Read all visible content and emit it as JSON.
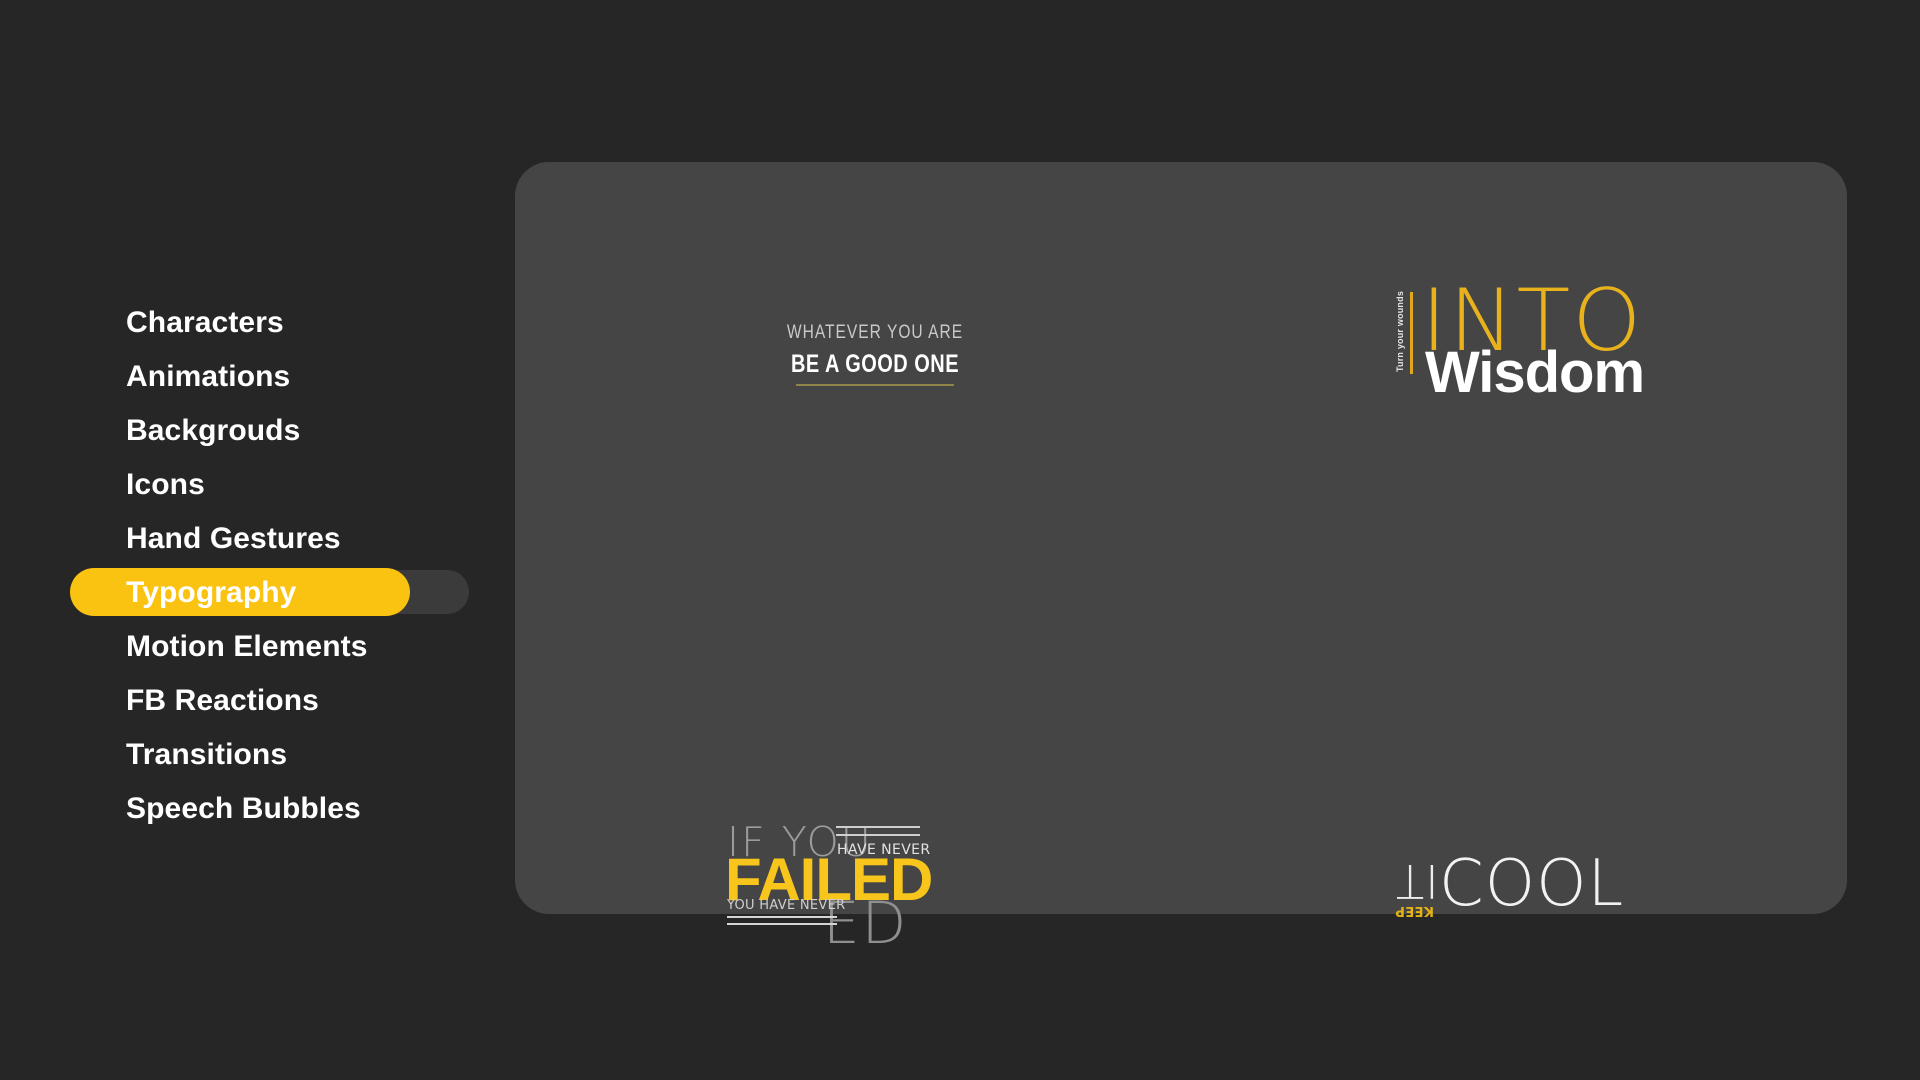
{
  "theme": {
    "page_background": "#262626",
    "panel_background": "#454545",
    "accent_yellow": "#fbc311",
    "text_primary": "#ffffff",
    "pill_track": "#3b3b3b"
  },
  "sidebar": {
    "items": [
      {
        "label": "Characters",
        "active": false
      },
      {
        "label": "Animations",
        "active": false
      },
      {
        "label": "Backgrouds",
        "active": false
      },
      {
        "label": "Icons",
        "active": false
      },
      {
        "label": "Hand Gestures",
        "active": false
      },
      {
        "label": "Typography",
        "active": true
      },
      {
        "label": "Motion Elements",
        "active": false
      },
      {
        "label": "FB Reactions",
        "active": false
      },
      {
        "label": "Transitions",
        "active": false
      },
      {
        "label": "Speech Bubbles",
        "active": false
      }
    ]
  },
  "panel": {
    "samples": {
      "good_one": {
        "line_top": "WHATEVER YOU ARE",
        "line_main": "BE A GOOD ONE",
        "rule_color": "#8e8546"
      },
      "wisdom": {
        "vertical_text": "Turn your wounds",
        "word_outline": "INTO",
        "word_bold": "Wisdom",
        "outline_color": "#e8b21d",
        "bar_color": "#e0a81d"
      },
      "failed": {
        "line_thin": "IF YOU",
        "line_small_top": "HAVE NEVER",
        "line_big": "FAILED",
        "line_small_bottom": "YOU HAVE NEVER",
        "ghost_text": "ED",
        "big_color": "#f8c51c"
      },
      "cool": {
        "word_rotated": "IT",
        "word_rotated_accent": "KEEP",
        "word_main": "COOL",
        "accent_color": "#e3b217"
      }
    }
  }
}
